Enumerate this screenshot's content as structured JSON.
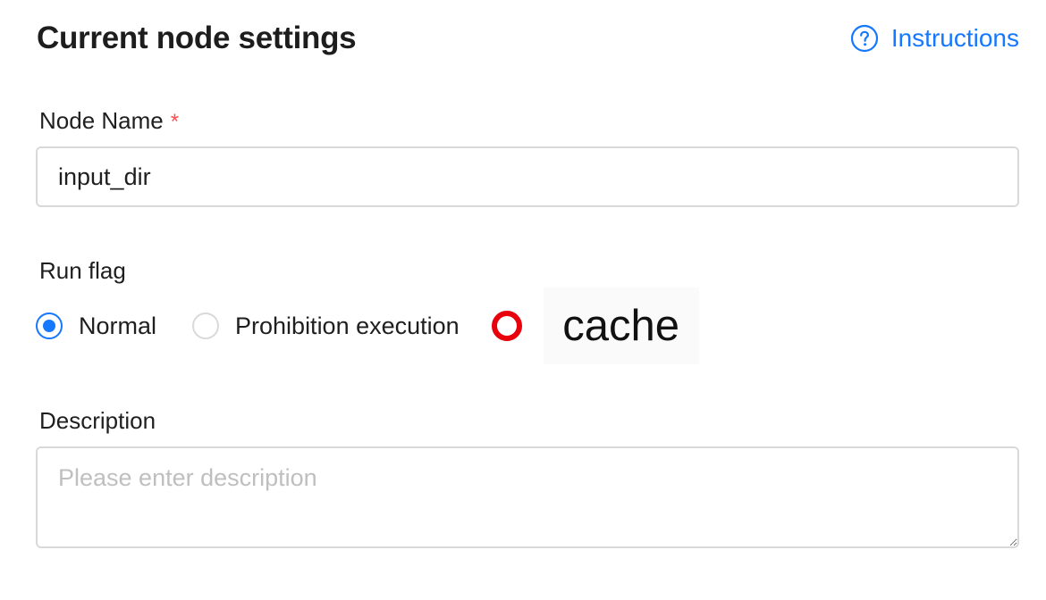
{
  "header": {
    "title": "Current node settings",
    "instructions_label": "Instructions",
    "link_color": "#1677ff",
    "help_icon": "question-circle-icon"
  },
  "node_name": {
    "label": "Node Name",
    "required_mark": "*",
    "value": "input_dir"
  },
  "run_flag": {
    "label": "Run flag",
    "options": [
      {
        "label": "Normal",
        "checked": true
      },
      {
        "label": "Prohibition execution",
        "checked": false
      },
      {
        "label": "cache",
        "checked": false
      }
    ],
    "selected": "Normal",
    "accent_color": "#1677ff",
    "cache_marker_color": "#e8000d"
  },
  "description": {
    "label": "Description",
    "placeholder": "Please enter description",
    "value": ""
  }
}
